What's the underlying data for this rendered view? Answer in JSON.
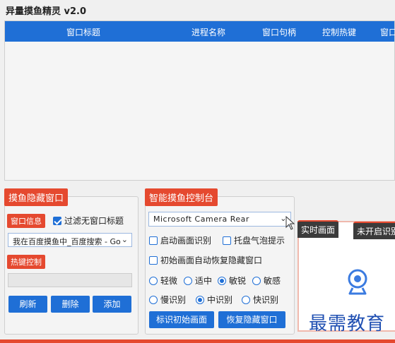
{
  "app": {
    "title": "异量摸鱼精灵 v2.0"
  },
  "table": {
    "columns": [
      "窗口标题",
      "进程名称",
      "窗口句柄",
      "控制热键",
      "窗口"
    ]
  },
  "hide_panel": {
    "tab": "摸鱼隐藏窗口",
    "window_info_tag": "窗口信息",
    "filter_label": "过滤无窗口标题",
    "filter_checked": true,
    "window_select_value": "我在百度摸鱼中_百度搜索 - Go",
    "hotkey_tag": "热键控制",
    "hotkey_value": "",
    "buttons": {
      "refresh": "刷新",
      "delete": "删除",
      "add": "添加"
    }
  },
  "control_panel": {
    "tab": "智能摸鱼控制台",
    "camera_select_value": "Microsoft Camera Rear",
    "options": {
      "start_recognition": "启动画面识别",
      "tray_bubble": "托盘气泡提示",
      "auto_restore": "初始画面自动恢复隐藏窗口"
    },
    "sensitivity": {
      "options": [
        "轻微",
        "适中",
        "敏锐",
        "敏感"
      ],
      "selected": "敏锐"
    },
    "speed": {
      "options": [
        "慢识别",
        "中识别",
        "快识别"
      ],
      "selected": "中识别"
    },
    "buttons": {
      "mark_initial": "标识初始画面",
      "restore_hidden": "恢复隐藏窗口"
    }
  },
  "video": {
    "tab_live": "实时画面",
    "tab_status": "未开启识别",
    "icon": "webcam-icon"
  },
  "watermark": "最需教育",
  "colors": {
    "accent_blue": "#1f6fd6",
    "accent_red": "#e5492f"
  }
}
